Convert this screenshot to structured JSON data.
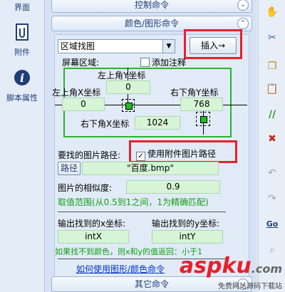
{
  "sidebar": {
    "items": [
      {
        "label": "界面"
      },
      {
        "label": "附件"
      },
      {
        "label": "脚本属性"
      }
    ]
  },
  "sections": {
    "control": "控制命令",
    "color": "颜色/图形命令",
    "other": "其它命令"
  },
  "form": {
    "command_select": "区域找图",
    "insert_button": "插入→",
    "screen_area_label": "屏幕区域:",
    "add_comment_label": "添加注释",
    "add_comment_checked": false,
    "top_left_y_label": "左上角Y坐标",
    "top_left_y": "0",
    "top_left_x_label": "左上角X坐标",
    "top_left_x": "0",
    "bottom_right_y_label": "右下角Y坐标",
    "bottom_right_y": "768",
    "bottom_right_x_label": "右下角X坐标",
    "bottom_right_x": "1024",
    "image_path_label": "要找的图片路径:",
    "use_attachment_label": "使用附件图片路径",
    "use_attachment_checked": true,
    "path_button": "路径",
    "path_value": "\"百度.bmp\"",
    "similarity_label": "图片的相似度:",
    "similarity_value": "0.9",
    "range_hint": "取值范围(从0.5到1之间，1为精确匹配)",
    "out_x_label": "输出找到的x坐标:",
    "out_x_value": "intX",
    "out_y_label": "输出找到的y坐标:",
    "out_y_value": "intY",
    "not_found_hint": "如果找不到颜色，则x和y的值返回：小于1",
    "help_link": "如何使用图形/颜色命令"
  },
  "toolbar": {
    "icons": [
      "hand-icon",
      "scissors-icon",
      "copy-icon",
      "paste-icon",
      "comment-icon",
      "uncomment-icon",
      "undo-icon",
      "redo-icon",
      "goto-icon",
      "find-icon"
    ]
  },
  "watermark": {
    "brand": "aspku",
    "tld": ".com",
    "tagline": "免费网站源码下载站"
  },
  "colors": {
    "highlight": "#e8202a",
    "field_green": "#d6f5d6",
    "hint_green": "#12a012",
    "link_blue": "#0033cc"
  }
}
